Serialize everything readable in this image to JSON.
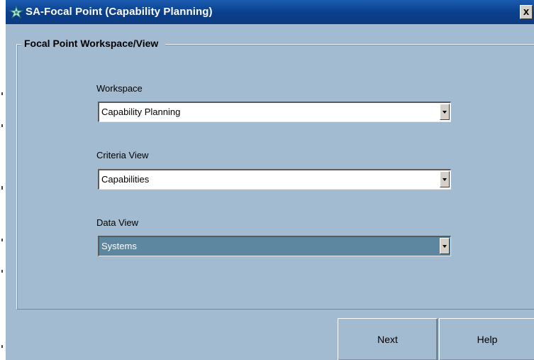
{
  "window": {
    "title": "SA-Focal Point (Capability Planning)",
    "close_label": "x",
    "icon": "sa-focal-point-app-icon"
  },
  "group": {
    "title": "Focal Point Workspace/View"
  },
  "fields": {
    "workspace": {
      "label": "Workspace",
      "value": "Capability Planning"
    },
    "criteria_view": {
      "label": "Criteria View",
      "value": "Capabilities"
    },
    "data_view": {
      "label": "Data View",
      "value": "Systems"
    }
  },
  "buttons": {
    "next": "Next",
    "help": "Help"
  },
  "colors": {
    "window_bg": "#a3bbd0",
    "titlebar": "#0a3e8a",
    "selected_combo": "#5d87a1"
  }
}
